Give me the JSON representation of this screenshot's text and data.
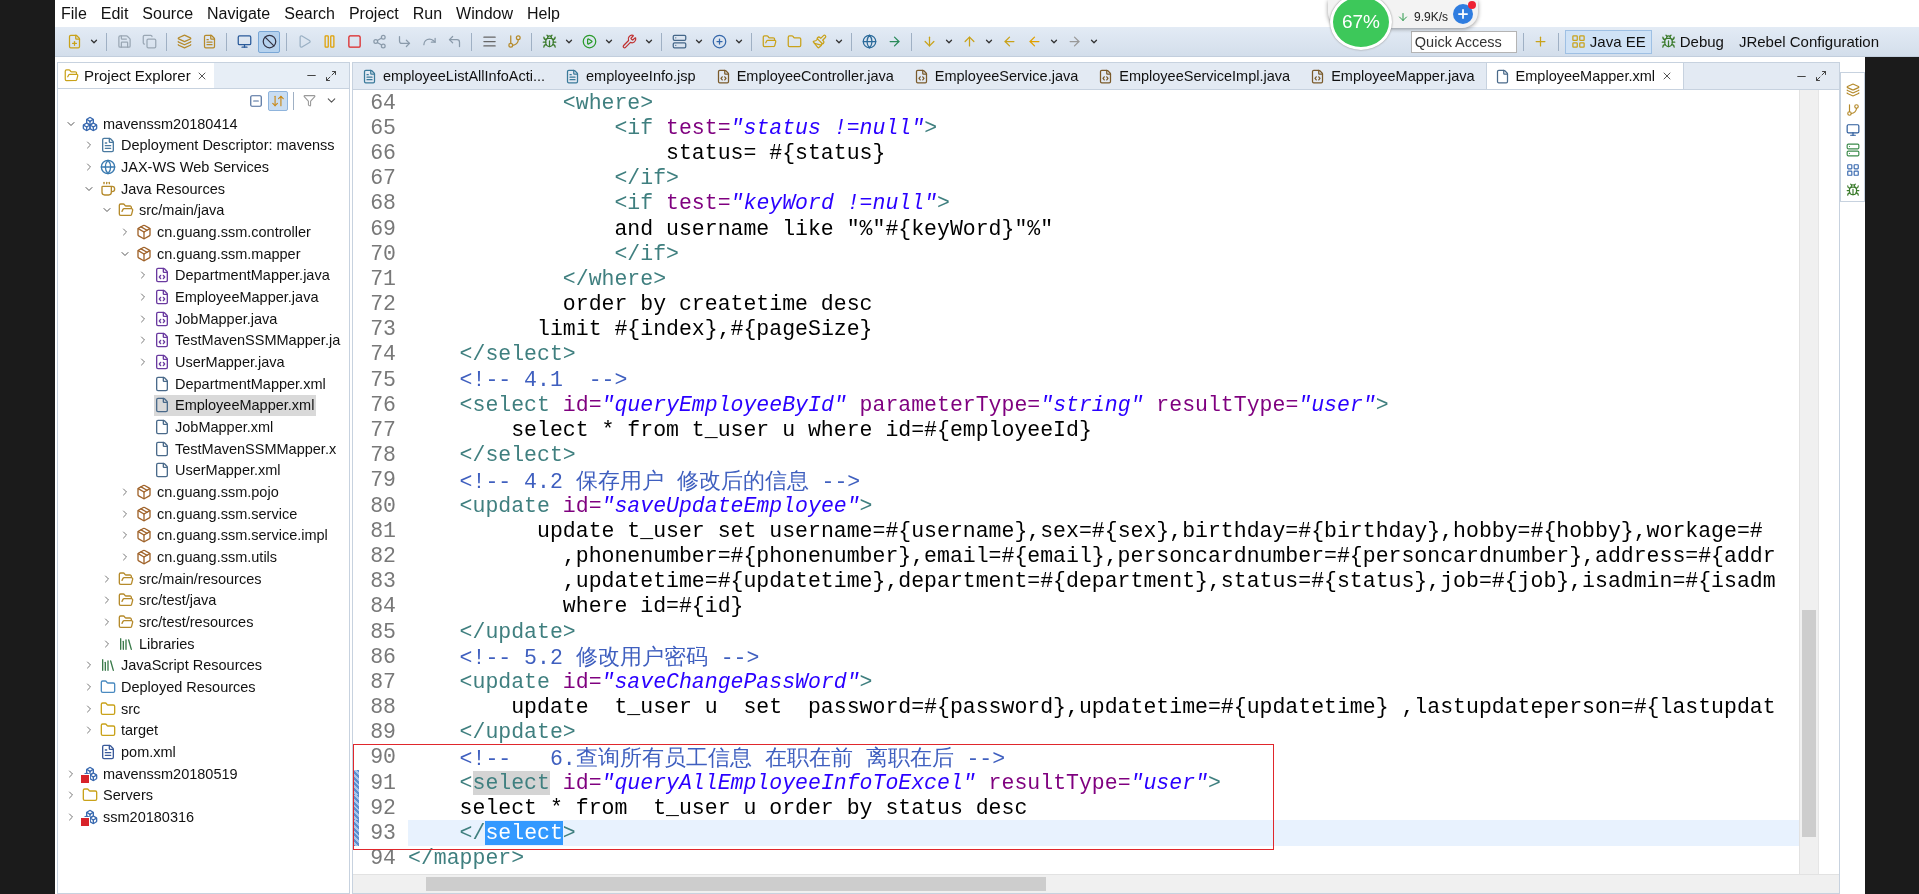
{
  "menu": [
    "File",
    "Edit",
    "Source",
    "Navigate",
    "Search",
    "Project",
    "Run",
    "Window",
    "Help"
  ],
  "toolbar": {
    "skip_breakpoints": {
      "on": true
    }
  },
  "network_widget": {
    "percent": "67%",
    "speed": "9.9K/s"
  },
  "quick_access": {
    "placeholder": "Quick Access"
  },
  "perspectives": [
    {
      "label": "Java EE",
      "selected": true
    },
    {
      "label": "Debug",
      "selected": false
    },
    {
      "label": "JRebel Configuration",
      "selected": false
    }
  ],
  "explorer": {
    "title": "Project Explorer",
    "link_with_editor": {
      "on": true
    },
    "tree": [
      {
        "label": "mavenssm20180414",
        "kind": "project",
        "error": false,
        "expanded": true,
        "selected": false,
        "children": [
          {
            "label": "Deployment Descriptor: mavenss",
            "kind": "descriptor",
            "expanded": false,
            "selected": false
          },
          {
            "label": "JAX-WS Web Services",
            "kind": "webservices",
            "expanded": false,
            "selected": false
          },
          {
            "label": "Java Resources",
            "kind": "java-resources",
            "expanded": true,
            "selected": false,
            "children": [
              {
                "label": "src/main/java",
                "kind": "source-folder",
                "expanded": true,
                "selected": false,
                "children": [
                  {
                    "label": "cn.guang.ssm.controller",
                    "kind": "package",
                    "expanded": false,
                    "selected": false
                  },
                  {
                    "label": "cn.guang.ssm.mapper",
                    "kind": "package",
                    "expanded": true,
                    "selected": false,
                    "children": [
                      {
                        "label": "DepartmentMapper.java",
                        "kind": "java-interface",
                        "expanded": false,
                        "selected": false
                      },
                      {
                        "label": "EmployeeMapper.java",
                        "kind": "java-interface",
                        "expanded": false,
                        "selected": false
                      },
                      {
                        "label": "JobMapper.java",
                        "kind": "java-interface",
                        "expanded": false,
                        "selected": false
                      },
                      {
                        "label": "TestMavenSSMMapper.ja",
                        "kind": "java-interface",
                        "expanded": false,
                        "selected": false
                      },
                      {
                        "label": "UserMapper.java",
                        "kind": "java-interface",
                        "expanded": false,
                        "selected": false
                      },
                      {
                        "label": "DepartmentMapper.xml",
                        "kind": "xml-file",
                        "selected": false
                      },
                      {
                        "label": "EmployeeMapper.xml",
                        "kind": "xml-file",
                        "selected": true
                      },
                      {
                        "label": "JobMapper.xml",
                        "kind": "xml-file",
                        "selected": false
                      },
                      {
                        "label": "TestMavenSSMMapper.x",
                        "kind": "xml-file",
                        "selected": false
                      },
                      {
                        "label": "UserMapper.xml",
                        "kind": "xml-file",
                        "selected": false
                      }
                    ]
                  },
                  {
                    "label": "cn.guang.ssm.pojo",
                    "kind": "package",
                    "expanded": false,
                    "selected": false
                  },
                  {
                    "label": "cn.guang.ssm.service",
                    "kind": "package",
                    "expanded": false,
                    "selected": false
                  },
                  {
                    "label": "cn.guang.ssm.service.impl",
                    "kind": "package",
                    "expanded": false,
                    "selected": false
                  },
                  {
                    "label": "cn.guang.ssm.utils",
                    "kind": "package",
                    "expanded": false,
                    "selected": false
                  }
                ]
              },
              {
                "label": "src/main/resources",
                "kind": "source-folder",
                "expanded": false,
                "selected": false
              },
              {
                "label": "src/test/java",
                "kind": "source-folder",
                "expanded": false,
                "selected": false
              },
              {
                "label": "src/test/resources",
                "kind": "source-folder",
                "expanded": false,
                "selected": false
              },
              {
                "label": "Libraries",
                "kind": "library",
                "expanded": false,
                "selected": false
              }
            ]
          },
          {
            "label": "JavaScript Resources",
            "kind": "library",
            "expanded": false,
            "selected": false
          },
          {
            "label": "Deployed Resources",
            "kind": "deployed",
            "expanded": false,
            "selected": false
          },
          {
            "label": "src",
            "kind": "folder",
            "expanded": false,
            "selected": false
          },
          {
            "label": "target",
            "kind": "folder",
            "expanded": false,
            "selected": false
          },
          {
            "label": "pom.xml",
            "kind": "maven-pom",
            "selected": false
          }
        ]
      },
      {
        "label": "mavenssm20180519",
        "kind": "project",
        "error": true,
        "expanded": false,
        "selected": false
      },
      {
        "label": "Servers",
        "kind": "folder",
        "expanded": false,
        "selected": false
      },
      {
        "label": "ssm20180316",
        "kind": "project",
        "error": true,
        "expanded": false,
        "selected": false
      }
    ]
  },
  "editor": {
    "tabs": [
      {
        "label": "employeeListAllInfoActi...",
        "kind": "jsp",
        "selected": false
      },
      {
        "label": "employeeInfo.jsp",
        "kind": "jsp",
        "selected": false
      },
      {
        "label": "EmployeeController.java",
        "kind": "java",
        "selected": false
      },
      {
        "label": "EmployeeService.java",
        "kind": "java",
        "selected": false
      },
      {
        "label": "EmployeeServiceImpl.java",
        "kind": "java",
        "selected": false
      },
      {
        "label": "EmployeeMapper.java",
        "kind": "java",
        "selected": false
      },
      {
        "label": "EmployeeMapper.xml",
        "kind": "xml",
        "selected": true
      }
    ],
    "lines": [
      {
        "number": "64",
        "current": false,
        "changed": false,
        "tokens": [
          {
            "kind": "tag",
            "text": "            <where>"
          }
        ]
      },
      {
        "number": "65",
        "current": false,
        "changed": false,
        "tokens": [
          {
            "kind": "tag",
            "text": "                <if"
          },
          {
            "kind": "attr",
            "text": " test="
          },
          {
            "kind": "value",
            "text": "\"status !=null\""
          },
          {
            "kind": "tag",
            "text": ">"
          }
        ]
      },
      {
        "number": "66",
        "current": false,
        "changed": false,
        "tokens": [
          {
            "kind": "text",
            "text": "                    status= #{status}"
          }
        ]
      },
      {
        "number": "67",
        "current": false,
        "changed": false,
        "tokens": [
          {
            "kind": "tag",
            "text": "                </if>"
          }
        ]
      },
      {
        "number": "68",
        "current": false,
        "changed": false,
        "tokens": [
          {
            "kind": "tag",
            "text": "                <if"
          },
          {
            "kind": "attr",
            "text": " test="
          },
          {
            "kind": "value",
            "text": "\"keyWord !=null\""
          },
          {
            "kind": "tag",
            "text": ">"
          }
        ]
      },
      {
        "number": "69",
        "current": false,
        "changed": false,
        "tokens": [
          {
            "kind": "text",
            "text": "                and username like \"%\"#{keyWord}\"%\""
          }
        ]
      },
      {
        "number": "70",
        "current": false,
        "changed": false,
        "tokens": [
          {
            "kind": "tag",
            "text": "                </if>"
          }
        ]
      },
      {
        "number": "71",
        "current": false,
        "changed": false,
        "tokens": [
          {
            "kind": "tag",
            "text": "            </where>"
          }
        ]
      },
      {
        "number": "72",
        "current": false,
        "changed": false,
        "tokens": [
          {
            "kind": "text",
            "text": "            order by createtime desc"
          }
        ]
      },
      {
        "number": "73",
        "current": false,
        "changed": false,
        "tokens": [
          {
            "kind": "text",
            "text": "          limit #{index},#{pageSize}"
          }
        ]
      },
      {
        "number": "74",
        "current": false,
        "changed": false,
        "tokens": [
          {
            "kind": "tag",
            "text": "    </select>"
          }
        ]
      },
      {
        "number": "75",
        "current": false,
        "changed": false,
        "tokens": [
          {
            "kind": "comment",
            "text": "    <!-- 4.1  -->"
          }
        ]
      },
      {
        "number": "76",
        "current": false,
        "changed": false,
        "tokens": [
          {
            "kind": "tag",
            "text": "    <select"
          },
          {
            "kind": "attr",
            "text": " id="
          },
          {
            "kind": "value",
            "text": "\"queryEmployeeById\""
          },
          {
            "kind": "attr",
            "text": " parameterType="
          },
          {
            "kind": "value",
            "text": "\"string\""
          },
          {
            "kind": "attr",
            "text": " resultType="
          },
          {
            "kind": "value",
            "text": "\"user\""
          },
          {
            "kind": "tag",
            "text": ">"
          }
        ]
      },
      {
        "number": "77",
        "current": false,
        "changed": false,
        "tokens": [
          {
            "kind": "text",
            "text": "        select * from t_user u where id=#{employeeId}"
          }
        ]
      },
      {
        "number": "78",
        "current": false,
        "changed": false,
        "tokens": [
          {
            "kind": "tag",
            "text": "    </select>"
          }
        ]
      },
      {
        "number": "79",
        "current": false,
        "changed": false,
        "tokens": [
          {
            "kind": "comment",
            "text": "    <!-- 4.2 保存用户 修改后的信息 -->"
          }
        ]
      },
      {
        "number": "80",
        "current": false,
        "changed": false,
        "tokens": [
          {
            "kind": "tag",
            "text": "    <update"
          },
          {
            "kind": "attr",
            "text": " id="
          },
          {
            "kind": "value",
            "text": "\"saveUpdateEmployee\""
          },
          {
            "kind": "tag",
            "text": ">"
          }
        ]
      },
      {
        "number": "81",
        "current": false,
        "changed": false,
        "tokens": [
          {
            "kind": "text",
            "text": "          update t_user set username=#{username},sex=#{sex},birthday=#{birthday},hobby=#{hobby},workage=#"
          }
        ]
      },
      {
        "number": "82",
        "current": false,
        "changed": false,
        "tokens": [
          {
            "kind": "text",
            "text": "            ,phonenumber=#{phonenumber},email=#{email},personcardnumber=#{personcardnumber},address=#{addr"
          }
        ]
      },
      {
        "number": "83",
        "current": false,
        "changed": false,
        "tokens": [
          {
            "kind": "text",
            "text": "            ,updatetime=#{updatetime},department=#{department},status=#{status},job=#{job},isadmin=#{isadm"
          }
        ]
      },
      {
        "number": "84",
        "current": false,
        "changed": false,
        "tokens": [
          {
            "kind": "text",
            "text": "            where id=#{id}"
          }
        ]
      },
      {
        "number": "85",
        "current": false,
        "changed": false,
        "tokens": [
          {
            "kind": "tag",
            "text": "    </update>"
          }
        ]
      },
      {
        "number": "86",
        "current": false,
        "changed": false,
        "tokens": [
          {
            "kind": "comment",
            "text": "    <!-- 5.2 修改用户密码 -->"
          }
        ]
      },
      {
        "number": "87",
        "current": false,
        "changed": false,
        "tokens": [
          {
            "kind": "tag",
            "text": "    <update"
          },
          {
            "kind": "attr",
            "text": " id="
          },
          {
            "kind": "value",
            "text": "\"saveChangePassWord\""
          },
          {
            "kind": "tag",
            "text": ">"
          }
        ]
      },
      {
        "number": "88",
        "current": false,
        "changed": false,
        "tokens": [
          {
            "kind": "text",
            "text": "        update  t_user u  set  password=#{password},updatetime=#{updatetime} ,lastupdateperson=#{lastupdat"
          }
        ]
      },
      {
        "number": "89",
        "current": false,
        "changed": false,
        "tokens": [
          {
            "kind": "tag",
            "text": "    </update>"
          }
        ]
      },
      {
        "number": "90",
        "current": false,
        "changed": false,
        "tokens": [
          {
            "kind": "comment",
            "text": "    <!--   6.查询所有员工信息 在职在前 离职在后 -->"
          }
        ]
      },
      {
        "number": "91",
        "current": false,
        "changed": true,
        "tokens": [
          {
            "kind": "tag",
            "text": "    <"
          },
          {
            "kind": "tag",
            "text": "select",
            "occurrence": true
          },
          {
            "kind": "attr",
            "text": " id="
          },
          {
            "kind": "value",
            "text": "\"queryAllEmployeeInfoToExcel\""
          },
          {
            "kind": "attr",
            "text": " resultType="
          },
          {
            "kind": "value",
            "text": "\"user\""
          },
          {
            "kind": "tag",
            "text": ">"
          }
        ]
      },
      {
        "number": "92",
        "current": false,
        "changed": true,
        "tokens": [
          {
            "kind": "text",
            "text": "    select * from  t_user u order by status desc"
          }
        ]
      },
      {
        "number": "93",
        "current": true,
        "changed": true,
        "tokens": [
          {
            "kind": "tag",
            "text": "    </"
          },
          {
            "kind": "tag",
            "text": "select",
            "selected": true
          },
          {
            "kind": "tag",
            "text": ">"
          }
        ]
      },
      {
        "number": "94",
        "current": false,
        "changed": false,
        "tokens": [
          {
            "kind": "tag",
            "text": "</mapper>"
          }
        ]
      }
    ]
  }
}
